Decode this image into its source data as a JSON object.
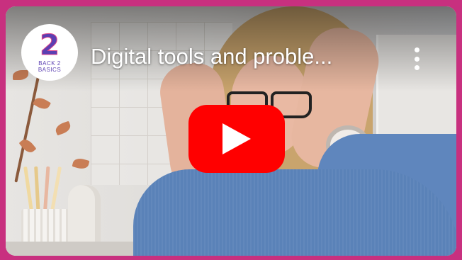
{
  "player": {
    "title": "Digital tools and proble...",
    "channel": {
      "logo_mark": "2",
      "logo_text_line1": "BACK 2",
      "logo_text_line2": "BASICS"
    },
    "icons": {
      "play": "play-icon",
      "more": "more-vert-icon"
    },
    "colors": {
      "background": "#c8307f",
      "play_button": "#ff0000",
      "logo": "#5b3fb2"
    }
  }
}
